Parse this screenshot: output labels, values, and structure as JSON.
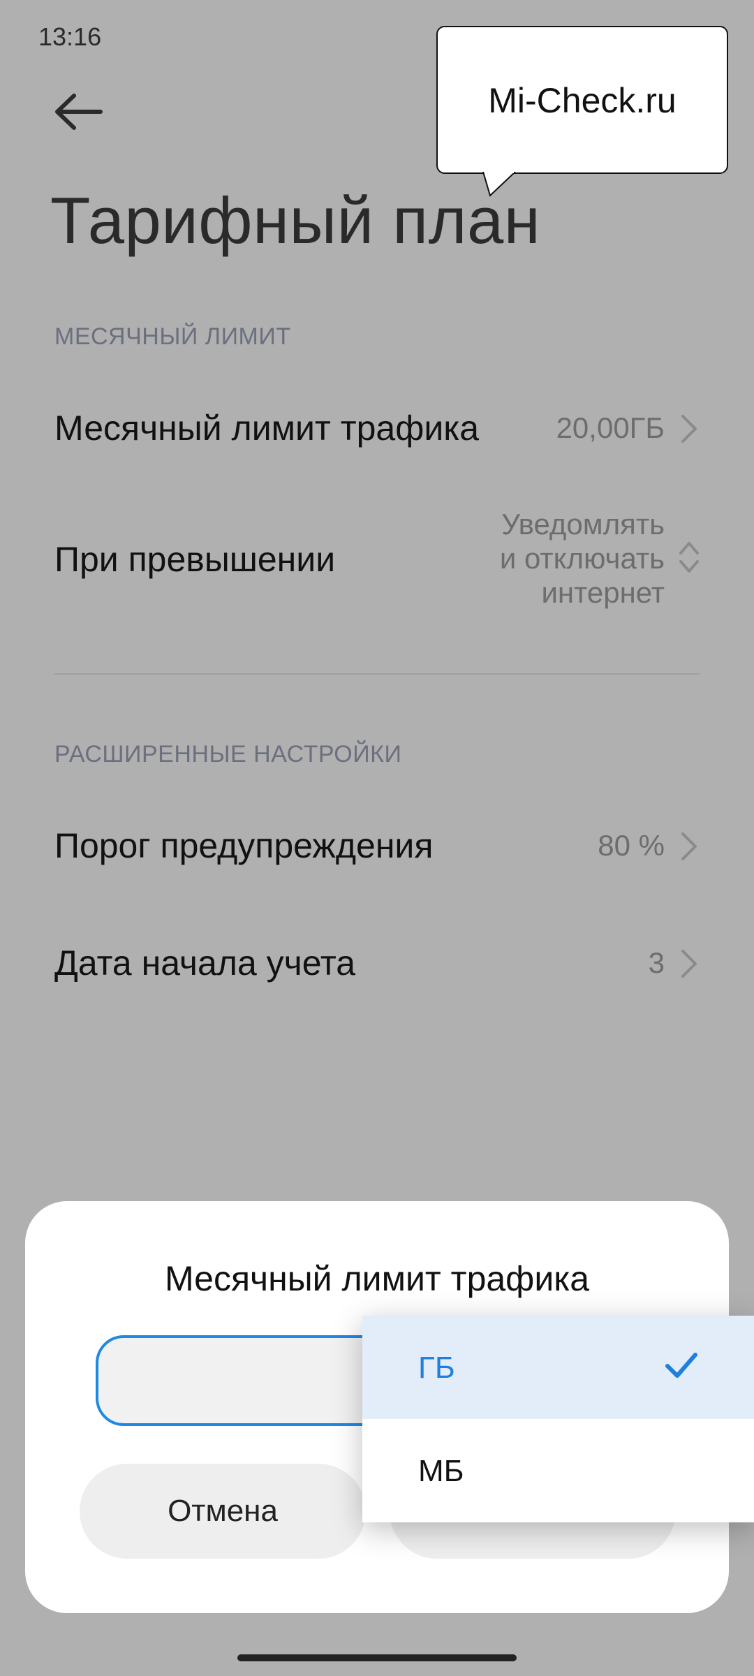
{
  "status_bar": {
    "time": "13:16"
  },
  "watermark": {
    "text": "Mi-Check.ru"
  },
  "header": {
    "title": "Тарифный план"
  },
  "sections": {
    "monthly": {
      "header": "МЕСЯЧНЫЙ ЛИМИТ",
      "limit_label": "Месячный лимит трафика",
      "limit_value": "20,00ГБ",
      "exceed_label": "При превышении",
      "exceed_value_line1": "Уведомлять",
      "exceed_value_line2": "и отключать",
      "exceed_value_line3": "интернет"
    },
    "advanced": {
      "header": "РАСШИРЕННЫЕ НАСТРОЙКИ",
      "threshold_label": "Порог предупреждения",
      "threshold_value": "80 %",
      "start_date_label": "Дата начала учета",
      "start_date_value": "3"
    }
  },
  "dialog": {
    "title": "Месячный лимит трафика",
    "input_value": "",
    "cancel_label": "Отмена"
  },
  "dropdown": {
    "options": [
      "ГБ",
      "МБ"
    ],
    "selected": "ГБ"
  },
  "colors": {
    "accent": "#1e88e5",
    "selected_bg": "#e3edf9",
    "overlay_bg": "#b0b0b0"
  }
}
